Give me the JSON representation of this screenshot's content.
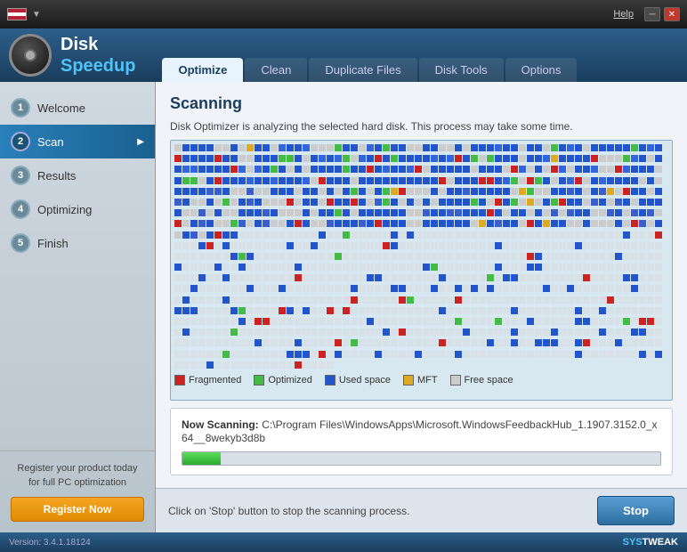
{
  "titlebar": {
    "help": "Help"
  },
  "header": {
    "app_disk": "Disk",
    "app_speedup": "Speedup"
  },
  "tabs": [
    {
      "label": "Optimize",
      "active": true
    },
    {
      "label": "Clean",
      "active": false
    },
    {
      "label": "Duplicate Files",
      "active": false
    },
    {
      "label": "Disk Tools",
      "active": false
    },
    {
      "label": "Options",
      "active": false
    }
  ],
  "sidebar": {
    "steps": [
      {
        "num": "1",
        "label": "Welcome",
        "active": false
      },
      {
        "num": "2",
        "label": "Scan",
        "active": true
      },
      {
        "num": "3",
        "label": "Results",
        "active": false
      },
      {
        "num": "4",
        "label": "Optimizing",
        "active": false
      },
      {
        "num": "5",
        "label": "Finish",
        "active": false
      }
    ],
    "register_text": "Register your product today for full PC optimization",
    "register_btn": "Register Now"
  },
  "content": {
    "title": "Scanning",
    "description": "Disk Optimizer is analyzing the selected hard disk. This process may take some time.",
    "legend": [
      {
        "label": "Fragmented",
        "color": "#cc2222"
      },
      {
        "label": "Optimized",
        "color": "#44bb44"
      },
      {
        "label": "Used space",
        "color": "#2255cc"
      },
      {
        "label": "MFT",
        "color": "#ddaa22"
      },
      {
        "label": "Free space",
        "color": "#cccccc"
      }
    ],
    "now_scanning_label": "Now Scanning:",
    "now_scanning_path": "C:\\Program Files\\WindowsApps\\Microsoft.WindowsFeedbackHub_1.1907.3152.0_x64__8wekyb3d8b",
    "progress_pct": 8
  },
  "bottom": {
    "message": "Click on 'Stop' button to stop the scanning process.",
    "stop_btn": "Stop"
  },
  "statusbar": {
    "version": "Version: 3.4.1.18124",
    "brand1": "SYS",
    "brand2": "TWEAK"
  }
}
